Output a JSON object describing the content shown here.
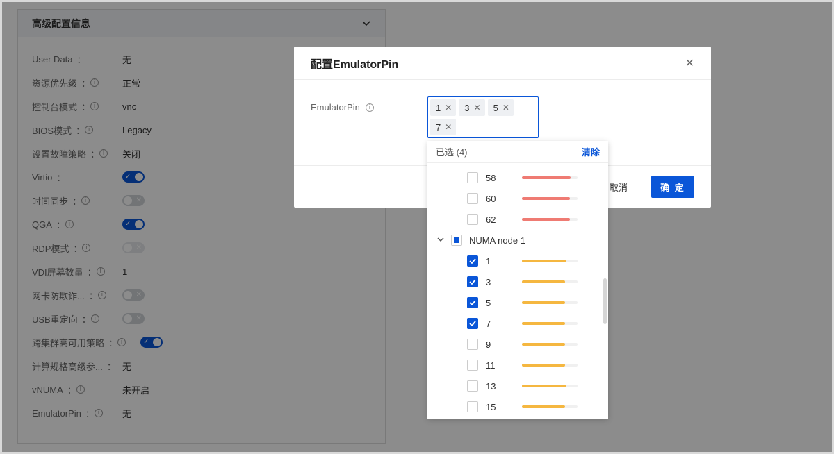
{
  "panel": {
    "title": "高级配置信息",
    "rows": [
      {
        "label": "User Data",
        "info": false,
        "type": "text",
        "value": "无"
      },
      {
        "label": "资源优先级",
        "info": true,
        "type": "text",
        "value": "正常"
      },
      {
        "label": "控制台模式",
        "info": true,
        "type": "text",
        "value": "vnc"
      },
      {
        "label": "BIOS模式",
        "info": true,
        "type": "text",
        "value": "Legacy"
      },
      {
        "label": "设置故障策略",
        "info": true,
        "type": "text",
        "value": "关闭"
      },
      {
        "label": "Virtio",
        "info": false,
        "type": "toggle",
        "state": "on"
      },
      {
        "label": "时间同步",
        "info": true,
        "type": "toggle",
        "state": "off"
      },
      {
        "label": "QGA",
        "info": true,
        "type": "toggle",
        "state": "on"
      },
      {
        "label": "RDP模式",
        "info": true,
        "type": "toggle",
        "state": "disabled"
      },
      {
        "label": "VDI屏幕数量",
        "info": true,
        "type": "text",
        "value": "1"
      },
      {
        "label": "网卡防欺诈...",
        "info": true,
        "type": "toggle",
        "state": "off"
      },
      {
        "label": "USB重定向",
        "info": true,
        "type": "toggle",
        "state": "off"
      },
      {
        "label": "跨集群高可用策略",
        "info": true,
        "type": "toggle",
        "state": "on"
      },
      {
        "label": "计算规格高级参...",
        "info": false,
        "type": "text",
        "value": "无"
      },
      {
        "label": "vNUMA",
        "info": true,
        "type": "text",
        "value": "未开启"
      },
      {
        "label": "EmulatorPin",
        "info": true,
        "type": "text",
        "value": "无"
      }
    ]
  },
  "modal": {
    "title": "配置EmulatorPin",
    "field_label": "EmulatorPin",
    "tags": [
      "1",
      "3",
      "5",
      "7"
    ],
    "cancel_label": "取消",
    "ok_label": "确 定"
  },
  "dropdown": {
    "selected_text": "已选 (4)",
    "clear_label": "清除",
    "items_before": [
      {
        "num": "58",
        "checked": false,
        "usage": 0.88,
        "color": "#ef7b73"
      },
      {
        "num": "60",
        "checked": false,
        "usage": 0.86,
        "color": "#ef7b73"
      },
      {
        "num": "62",
        "checked": false,
        "usage": 0.86,
        "color": "#ef7b73"
      }
    ],
    "group": {
      "name": "NUMA node 1",
      "state": "partial"
    },
    "items_after": [
      {
        "num": "1",
        "checked": true,
        "usage": 0.8,
        "color": "#f5b740"
      },
      {
        "num": "3",
        "checked": true,
        "usage": 0.77,
        "color": "#f5b740"
      },
      {
        "num": "5",
        "checked": true,
        "usage": 0.78,
        "color": "#f5b740"
      },
      {
        "num": "7",
        "checked": true,
        "usage": 0.78,
        "color": "#f5b740"
      },
      {
        "num": "9",
        "checked": false,
        "usage": 0.78,
        "color": "#f5b740"
      },
      {
        "num": "11",
        "checked": false,
        "usage": 0.78,
        "color": "#f5b740"
      },
      {
        "num": "13",
        "checked": false,
        "usage": 0.8,
        "color": "#f5b740"
      },
      {
        "num": "15",
        "checked": false,
        "usage": 0.78,
        "color": "#f5b740"
      }
    ]
  },
  "colors": {
    "primary": "#0a56d8",
    "bar_red": "#ef7b73",
    "bar_orange": "#f5b740"
  }
}
